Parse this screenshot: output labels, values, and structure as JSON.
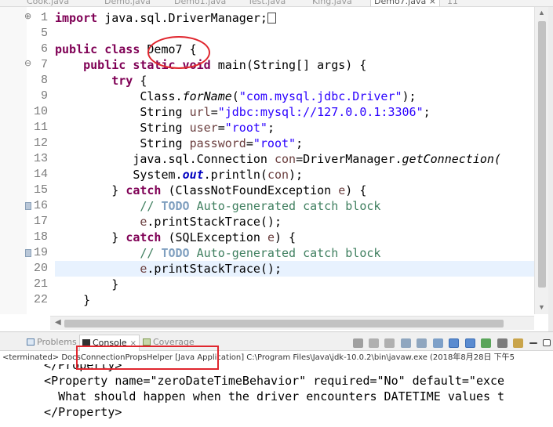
{
  "editor_tabs": [
    {
      "label": "Cook.java"
    },
    {
      "label": "Demo.java"
    },
    {
      "label": "Demo1.java"
    },
    {
      "label": "Test.java"
    },
    {
      "label": "King.java"
    },
    {
      "label": "Demo7.java",
      "close": "×",
      "hidden_count": "11"
    }
  ],
  "line_numbers": [
    "1",
    "5",
    "6",
    "7",
    "8",
    "9",
    "10",
    "11",
    "12",
    "13",
    "14",
    "15",
    "16",
    "17",
    "18",
    "19",
    "20",
    "21",
    "22"
  ],
  "code": {
    "l1_kw": "import",
    "l1_rest": " java.sql.DriverManager;",
    "l6_kw": "public class",
    "l6_name": " Demo7 {",
    "l7_indent": "    ",
    "l7_kw1": "public static void",
    "l7_rest": " main(String[] args) {",
    "l8_indent": "        ",
    "l8_kw": "try",
    "l8_rest": " {",
    "l9_pre": "            Class.",
    "l9_method": "forName",
    "l9_open": "(",
    "l9_str": "\"com.mysql.jdbc.Driver\"",
    "l9_close": ");",
    "l10_pre": "            String ",
    "l10_var": "url",
    "l10_eq": "=",
    "l10_str": "\"jdbc:mysql://127.0.0.1:3306\"",
    "l10_end": ";",
    "l11_pre": "            String ",
    "l11_var": "user",
    "l11_eq": "=",
    "l11_str": "\"root\"",
    "l11_end": ";",
    "l12_pre": "            String ",
    "l12_var": "password",
    "l12_eq": "=",
    "l12_str": "\"root\"",
    "l12_end": ";",
    "l13_pre": "           java.sql.Connection ",
    "l13_var": "con",
    "l13_mid": "=DriverManager.",
    "l13_method": "getConnection(",
    "l14_pre": "           System.",
    "l14_field": "out",
    "l14_rest": ".println(",
    "l14_var": "con",
    "l14_end": ");",
    "l15_pre": "        } ",
    "l15_kw": "catch",
    "l15_rest": " (ClassNotFoundException ",
    "l15_var": "e",
    "l15_end": ") {",
    "l16_pre": "            ",
    "l16_cm1": "// ",
    "l16_todo": "TODO",
    "l16_cm2": " Auto-generated catch block",
    "l17_pre": "            ",
    "l17_var": "e",
    "l17_rest": ".printStackTrace();",
    "l18_pre": "        } ",
    "l18_kw": "catch",
    "l18_rest": " (SQLException ",
    "l18_var": "e",
    "l18_end": ") {",
    "l19_pre": "            ",
    "l19_cm1": "// ",
    "l19_todo": "TODO",
    "l19_cm2": " Auto-generated catch block",
    "l20_pre": "            ",
    "l20_var": "e",
    "l20_rest": ".printStackTrace();",
    "l21": "        }",
    "l22": "    }"
  },
  "console": {
    "tabs": [
      {
        "label": "Problems"
      },
      {
        "label": "Console",
        "close": "×"
      },
      {
        "label": "Coverage"
      }
    ],
    "status_prefix": "<terminated> ",
    "status_app": "DocsConnectionPropsHelper [Java Application]",
    "status_rest": " C:\\Program Files\\Java\\jdk-10.0.2\\bin\\javaw.exe (2018年8月28日 下午5",
    "output_lines": [
      "  </Property>",
      "  <Property name=\"zeroDateTimeBehavior\" required=\"No\" default=\"exce",
      "    What should happen when the driver encounters DATETIME values t",
      "  </Property>"
    ]
  },
  "colors": {
    "keyword": "#7f0055",
    "string": "#2a00ff",
    "local_variable": "#6a3e3e",
    "comment": "#3f7f5f",
    "annotation_red": "#e0262e",
    "current_line": "#e8f2fe"
  }
}
